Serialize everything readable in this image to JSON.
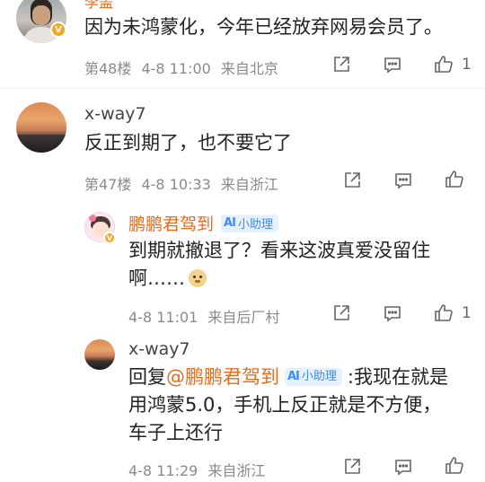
{
  "comments": [
    {
      "user": "",
      "top_partial_name": "李盖",
      "text": "因为未鸿蒙化，今年已经放弃网易会员了。",
      "floor": "第48楼",
      "date": "4-8 11:00",
      "location": "来自北京",
      "likes": "1"
    },
    {
      "user": "x-way7",
      "text": "反正到期了，也不要它了",
      "floor": "第47楼",
      "date": "4-8 10:33",
      "location": "来自浙江",
      "likes": ""
    }
  ],
  "replies": [
    {
      "user": "鹏鹏君驾到",
      "badge": "小助理",
      "text_line1": "到期就撤退了？看来这波真爱没留住",
      "text_line2": "啊……",
      "date": "4-8 11:01",
      "location": "来自后厂村",
      "likes": "1"
    },
    {
      "user": "x-way7",
      "reply_prefix": "回复",
      "mention": "@鹏鹏君驾到",
      "badge": "小助理",
      "text_line1_after": ":我现在就是",
      "text_line2": "用鸿蒙5.0，手机上反正就是不方便，",
      "text_line3": "车子上还行",
      "date": "4-8 11:29",
      "location": "来自浙江",
      "likes": ""
    }
  ],
  "icons": [
    "share-icon",
    "comment-icon",
    "like-icon"
  ]
}
